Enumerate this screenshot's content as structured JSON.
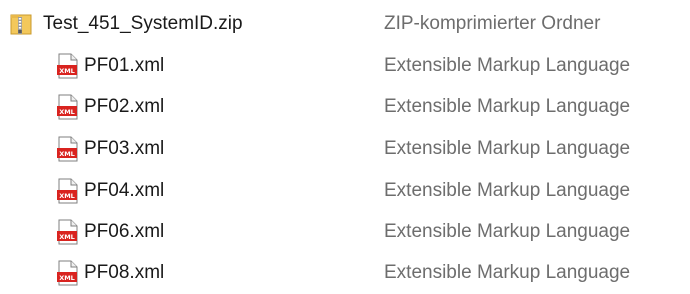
{
  "files": [
    {
      "name": "Test_451_SystemID.zip",
      "type": "ZIP-komprimierter Ordner",
      "icon": "zip-folder-icon"
    },
    {
      "name": "PF01.xml",
      "type": "Extensible Markup Language",
      "icon": "xml-file-icon"
    },
    {
      "name": "PF02.xml",
      "type": "Extensible Markup Language",
      "icon": "xml-file-icon"
    },
    {
      "name": "PF03.xml",
      "type": "Extensible Markup Language",
      "icon": "xml-file-icon"
    },
    {
      "name": "PF04.xml",
      "type": "Extensible Markup Language",
      "icon": "xml-file-icon"
    },
    {
      "name": "PF06.xml",
      "type": "Extensible Markup Language",
      "icon": "xml-file-icon"
    },
    {
      "name": "PF08.xml",
      "type": "Extensible Markup Language",
      "icon": "xml-file-icon"
    }
  ],
  "colors": {
    "zip_folder": "#e8b84a",
    "xml_badge": "#d9231f",
    "type_text": "#6d6d6d"
  }
}
